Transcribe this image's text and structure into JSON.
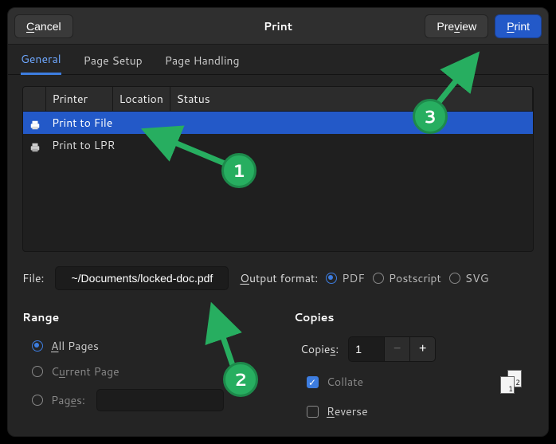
{
  "titlebar": {
    "cancel": "Cancel",
    "title": "Print",
    "preview": "Preview",
    "print": "Print"
  },
  "tabs": [
    {
      "label": "General",
      "active": true
    },
    {
      "label": "Page Setup",
      "active": false
    },
    {
      "label": "Page Handling",
      "active": false
    }
  ],
  "printer_table": {
    "headers": [
      "",
      "Printer",
      "Location",
      "Status"
    ],
    "rows": [
      {
        "name": "Print to File",
        "location": "",
        "status": "",
        "selected": true
      },
      {
        "name": "Print to LPR",
        "location": "",
        "status": "",
        "selected": false
      }
    ]
  },
  "file": {
    "label": "File:",
    "value": "~/Documents/locked-doc.pdf"
  },
  "output_format": {
    "label": "Output format:",
    "options": [
      {
        "id": "pdf",
        "label": "PDF",
        "checked": true
      },
      {
        "id": "ps",
        "label": "Postscript",
        "checked": false
      },
      {
        "id": "svg",
        "label": "SVG",
        "checked": false
      }
    ]
  },
  "range": {
    "title": "Range",
    "all_pages": "All Pages",
    "current_page": "Current Page",
    "pages": "Pages:",
    "pages_value": "",
    "selected": "all"
  },
  "copies": {
    "title": "Copies",
    "label": "Copies:",
    "value": "1",
    "collate": "Collate",
    "collate_checked": true,
    "reverse": "Reverse",
    "reverse_checked": false
  },
  "annotations": {
    "b1": "1",
    "b2": "2",
    "b3": "3"
  }
}
